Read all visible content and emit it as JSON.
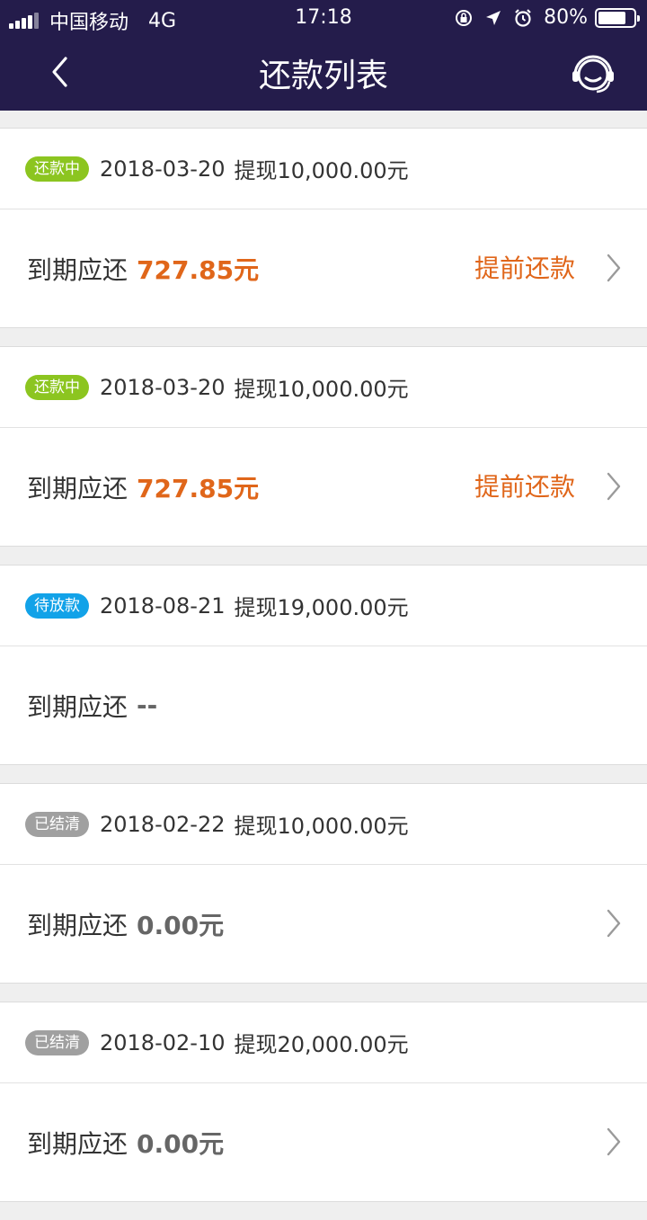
{
  "status": {
    "carrier": "中国移动",
    "network": "4G",
    "time": "17:18",
    "battery": "80%",
    "battery_level": 0.8
  },
  "nav": {
    "title": "还款列表"
  },
  "colors": {
    "header_bg": "#241c4b",
    "orange": "#e0661a",
    "green_badge": "#8cc520",
    "blue_badge": "#12a2e8",
    "gray_badge": "#a0a0a0",
    "gray_text": "#666666"
  },
  "loans": [
    {
      "badge": "还款中",
      "badge_color": "#8cc520",
      "date": "2018-03-20",
      "withdraw_label": "提现",
      "withdraw_amount": "10,000.00元",
      "due_label": "到期应还",
      "due_amount": "727.85元",
      "due_color": "#e0661a",
      "action": "提前还款"
    },
    {
      "badge": "还款中",
      "badge_color": "#8cc520",
      "date": "2018-03-20",
      "withdraw_label": "提现",
      "withdraw_amount": "10,000.00元",
      "due_label": "到期应还",
      "due_amount": "727.85元",
      "due_color": "#e0661a",
      "action": "提前还款"
    },
    {
      "badge": "待放款",
      "badge_color": "#12a2e8",
      "date": "2018-08-21",
      "withdraw_label": "提现",
      "withdraw_amount": "19,000.00元",
      "due_label": "到期应还",
      "due_amount": "--",
      "due_color": "#666666",
      "action": ""
    },
    {
      "badge": "已结清",
      "badge_color": "#a0a0a0",
      "date": "2018-02-22",
      "withdraw_label": "提现",
      "withdraw_amount": "10,000.00元",
      "due_label": "到期应还",
      "due_amount": "0.00元",
      "due_color": "#666666",
      "action": ""
    },
    {
      "badge": "已结清",
      "badge_color": "#a0a0a0",
      "date": "2018-02-10",
      "withdraw_label": "提现",
      "withdraw_amount": "20,000.00元",
      "due_label": "到期应还",
      "due_amount": "0.00元",
      "due_color": "#666666",
      "action": ""
    }
  ]
}
